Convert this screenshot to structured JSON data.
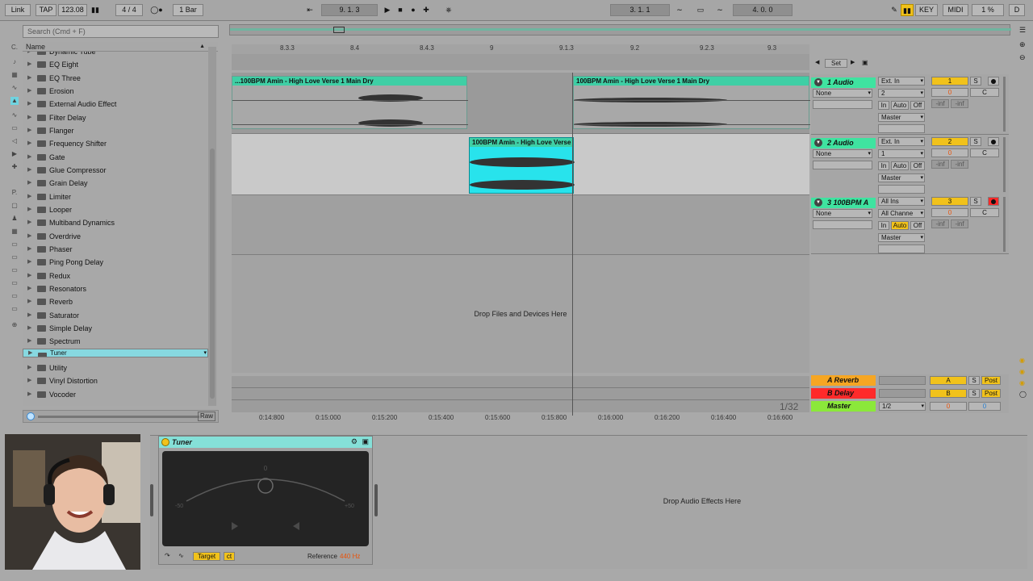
{
  "transport": {
    "link": "Link",
    "tap": "TAP",
    "tempo": "123.08",
    "signature": "4 / 4",
    "quantize": "1 Bar",
    "position": "9.  1.  3",
    "loop_start": "3.  1.  1",
    "loop_length": "4.  0.  0",
    "key": "KEY",
    "midi": "MIDI",
    "cpu": "1 %",
    "d": "D"
  },
  "browser": {
    "search_placeholder": "Search (Cmd + F)",
    "column_header": "Name",
    "items": [
      "Dynamic Tube",
      "EQ Eight",
      "EQ Three",
      "Erosion",
      "External Audio Effect",
      "Filter Delay",
      "Flanger",
      "Frequency Shifter",
      "Gate",
      "Glue Compressor",
      "Grain Delay",
      "Limiter",
      "Looper",
      "Multiband Dynamics",
      "Overdrive",
      "Phaser",
      "Ping Pong Delay",
      "Redux",
      "Resonators",
      "Reverb",
      "Saturator",
      "Simple Delay",
      "Spectrum",
      "Tuner",
      "Utility",
      "Vinyl Distortion",
      "Vocoder"
    ],
    "selected_index": 23,
    "preview_raw": "Raw"
  },
  "arrangement": {
    "ruler": [
      "8.3.3",
      "8.4",
      "8.4.3",
      "9",
      "9.1.3",
      "9.2",
      "9.2.3",
      "9.3"
    ],
    "clip_track1_a": "...100BPM Amin - High Love Verse 1 Main Dry",
    "clip_track1_b": "100BPM Amin - High Love Verse 1 Main Dry",
    "clip_track2": "100BPM Amin - High Love Verse",
    "drop_files": "Drop Files and Devices Here",
    "zoom": "1/32",
    "timeline": [
      "0:14:800",
      "0:15:000",
      "0:15:200",
      "0:15:400",
      "0:15:600",
      "0:15:800",
      "0:16:000",
      "0:16:200",
      "0:16:400",
      "0:16:600"
    ]
  },
  "mixer": {
    "set": "Set",
    "tracks": [
      {
        "name": "1 Audio",
        "input": "Ext. In",
        "channel": "2",
        "num": "1",
        "s": "S",
        "vol": "0",
        "pan": "C",
        "monitor_in": "In",
        "auto": "Auto",
        "off": "Off",
        "inf1": "-inf",
        "inf2": "-inf",
        "out": "Master",
        "route": "None"
      },
      {
        "name": "2 Audio",
        "input": "Ext. In",
        "channel": "1",
        "num": "2",
        "s": "S",
        "vol": "0",
        "pan": "C",
        "monitor_in": "In",
        "auto": "Auto",
        "off": "Off",
        "inf1": "-inf",
        "inf2": "-inf",
        "out": "Master",
        "route": "None"
      },
      {
        "name": "3 100BPM A",
        "input": "All Ins",
        "channel": "All Channe",
        "num": "3",
        "s": "S",
        "vol": "0",
        "pan": "C",
        "monitor_in": "In",
        "auto": "Auto",
        "off": "Off",
        "inf1": "-inf",
        "inf2": "-inf",
        "out": "Master",
        "route": "None"
      }
    ],
    "returns": [
      {
        "name": "A Reverb",
        "letter": "A",
        "s": "S",
        "post": "Post",
        "color": "#f6a623"
      },
      {
        "name": "B Delay",
        "letter": "B",
        "s": "S",
        "post": "Post",
        "color": "#ff2a2a"
      }
    ],
    "master": {
      "name": "Master",
      "route": "1/2",
      "vol": "0",
      "pan": "0"
    }
  },
  "devices": {
    "tuner_title": "Tuner",
    "tuner_zero": "0",
    "tuner_minus": "-50",
    "tuner_plus": "+50",
    "target": "Target",
    "ct": "ct",
    "reference_label": "Reference",
    "reference_value": "440 Hz",
    "drop_fx": "Drop Audio Effects Here"
  },
  "colors": {
    "clip_green": "#3fcfa5",
    "selected_clip": "#28e3ec",
    "track_yellow": "#f1c21b",
    "browser_selected": "#87d8e0"
  }
}
